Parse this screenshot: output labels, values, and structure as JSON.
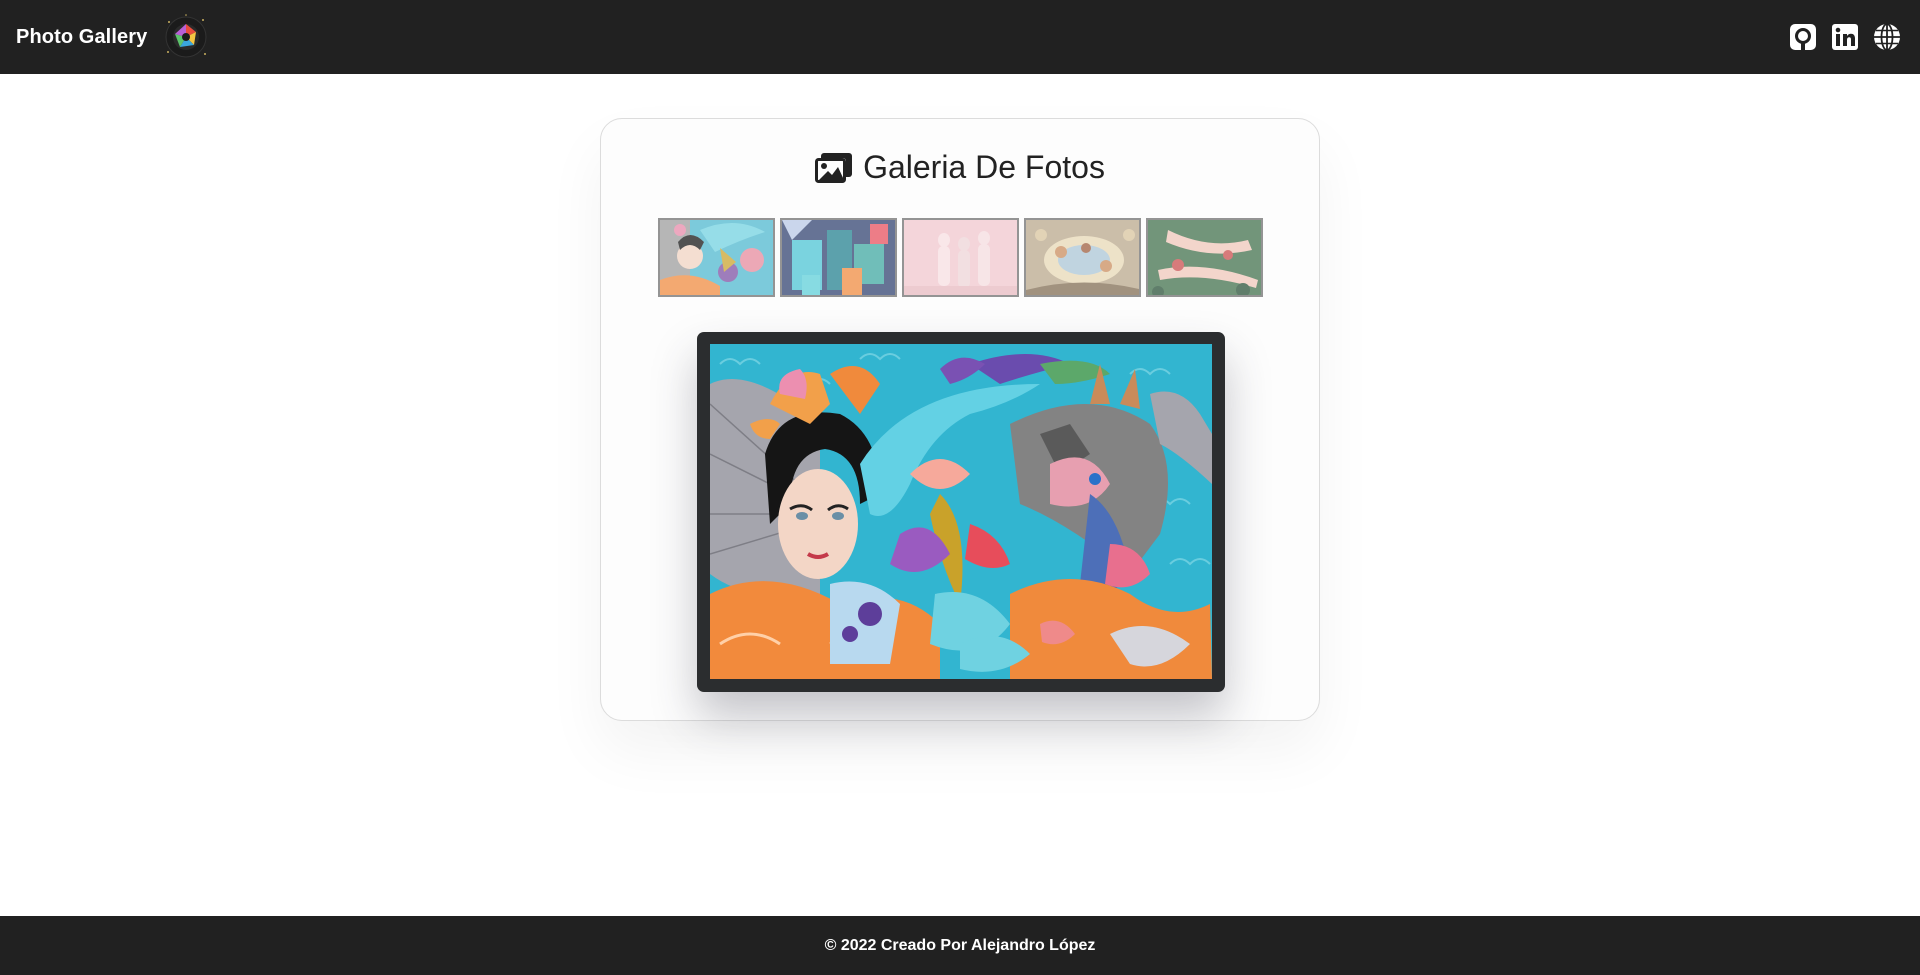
{
  "navbar": {
    "brand": "Photo Gallery",
    "icons": [
      "github-icon",
      "linkedin-icon",
      "globe-icon"
    ]
  },
  "gallery": {
    "title": "Galeria De Fotos",
    "title_icon": "images-icon",
    "thumbnails": [
      {
        "name": "thumbnail-mural-woman",
        "theme": "colorful mural"
      },
      {
        "name": "thumbnail-abstract-blue",
        "theme": "abstract blue"
      },
      {
        "name": "thumbnail-pink-statues",
        "theme": "pink statues"
      },
      {
        "name": "thumbnail-ceiling-fresco",
        "theme": "fresco"
      },
      {
        "name": "thumbnail-green-figure",
        "theme": "green"
      }
    ],
    "main_image": "mural-woman"
  },
  "footer": {
    "text": "© 2022 Creado Por Alejandro López"
  },
  "colors": {
    "nav_bg": "#212121",
    "frame": "#2b2d2f",
    "card_border": "#dcdcdc"
  }
}
